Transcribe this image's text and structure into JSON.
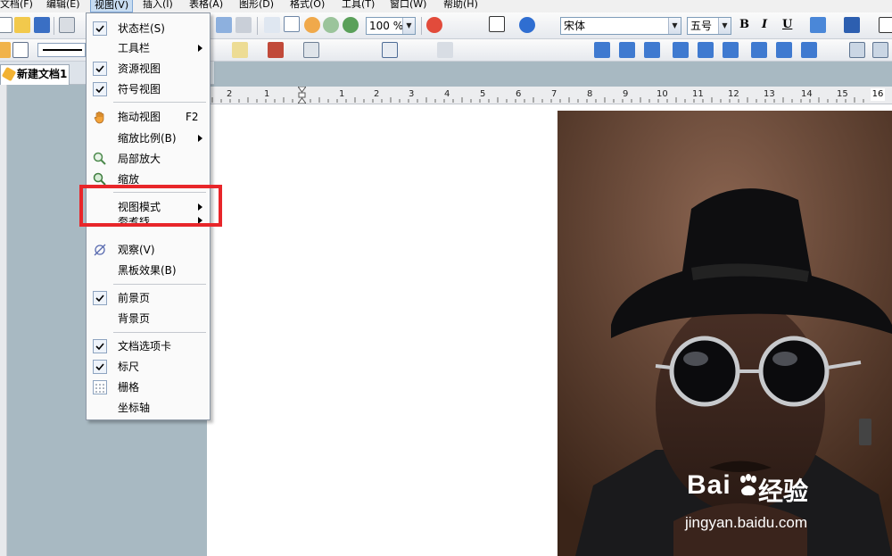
{
  "menubar": {
    "items": [
      {
        "label": "文档(F)"
      },
      {
        "label": "编辑(E)"
      },
      {
        "label": "视图(V)"
      },
      {
        "label": "插入(I)"
      },
      {
        "label": "表格(A)"
      },
      {
        "label": "图形(D)"
      },
      {
        "label": "格式(O)"
      },
      {
        "label": "工具(T)"
      },
      {
        "label": "窗口(W)"
      },
      {
        "label": "帮助(H)"
      }
    ]
  },
  "toolbar": {
    "zoom_value": "100 %",
    "font_name": "宋体",
    "font_size": "五号",
    "bold_label": "B",
    "italic_label": "I",
    "underline_label": "U"
  },
  "tabs": {
    "doc_tab": "新建文档1"
  },
  "ruler": {
    "numbers": [
      "2",
      "1",
      "1",
      "2",
      "3",
      "4",
      "5",
      "6",
      "7",
      "8",
      "9",
      "10",
      "11",
      "12",
      "13",
      "14",
      "15"
    ],
    "end_label": "16"
  },
  "view_menu": {
    "items": [
      {
        "label": "状态栏(S)",
        "checked": true
      },
      {
        "label": "工具栏",
        "submenu": true
      },
      {
        "label": "资源视图",
        "checked": true
      },
      {
        "label": "符号视图",
        "checked": true
      },
      {
        "label": "拖动视图",
        "shortcut": "F2",
        "icon": "hand-icon"
      },
      {
        "label": "缩放比例(B)",
        "submenu": true
      },
      {
        "label": "局部放大",
        "icon": "magnifier-icon"
      },
      {
        "label": "缩放",
        "icon": "zoom-icon"
      },
      {
        "label": "视图模式",
        "submenu": true
      },
      {
        "label": "参考线",
        "submenu": true
      },
      {
        "label": "观察(V)",
        "icon": "observe-icon"
      },
      {
        "label": "黑板效果(B)"
      },
      {
        "label": "前景页",
        "checked": true
      },
      {
        "label": "背景页"
      },
      {
        "label": "文档选项卡",
        "checked": true
      },
      {
        "label": "标尺",
        "checked": true
      },
      {
        "label": "栅格",
        "icon": "grid-icon"
      },
      {
        "label": "坐标轴"
      }
    ]
  },
  "watermark": {
    "logo": "Bai",
    "logo_suffix": "经验",
    "url": "jingyan.baidu.com"
  },
  "colors": {
    "highlight": "#e8262a",
    "workspace": "#a8b9c2"
  }
}
